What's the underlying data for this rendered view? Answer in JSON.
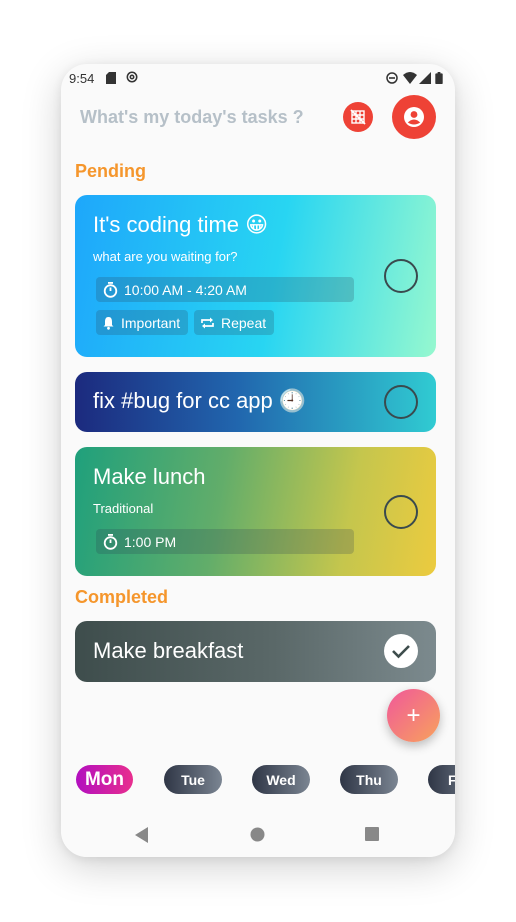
{
  "status_bar": {
    "time": "9:54"
  },
  "header": {
    "title": "What's my today's tasks ?"
  },
  "sections": {
    "pending": "Pending",
    "completed": "Completed"
  },
  "tasks": [
    {
      "title": "It's coding time 😀",
      "subtitle": "what are you waiting for?",
      "time": "10:00 AM - 4:20 AM",
      "tags": [
        "Important",
        "Repeat"
      ],
      "done": false
    },
    {
      "title": "fix #bug for cc app 🕘",
      "done": false
    },
    {
      "title": "Make lunch",
      "subtitle": "Traditional",
      "time": "1:00 PM",
      "done": false
    },
    {
      "title": "Make breakfast",
      "done": true
    }
  ],
  "fab": {
    "label": "+"
  },
  "days": [
    "Mon",
    "Tue",
    "Wed",
    "Thu",
    "Fri"
  ],
  "selected_day": "Mon",
  "colors": {
    "accent": "#ee4236",
    "section": "#f5962c",
    "header_text": "#b6c0c8"
  },
  "icons": [
    "sd-card-icon",
    "at-icon",
    "dnd-icon",
    "wifi-icon",
    "signal-icon",
    "battery-icon",
    "grid-off-icon",
    "account-icon",
    "timer-icon",
    "bell-icon",
    "repeat-icon",
    "check-icon",
    "back-icon",
    "home-icon",
    "recents-icon"
  ]
}
